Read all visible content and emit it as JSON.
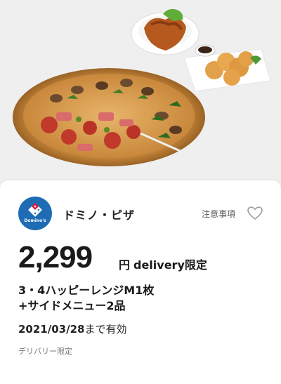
{
  "brand": {
    "name": "ドミノ・ピザ",
    "logo_text": "Domino's",
    "color": "#1e6db4",
    "accent": "#e31837"
  },
  "notes_link": "注意事項",
  "favorite_icon": "heart-outline-icon",
  "price": {
    "amount": "2,299",
    "currency": "円",
    "tag": "delivery限定"
  },
  "description": {
    "line1": "3・4ハッピーレンジM1枚",
    "line2": "+サイドメニュー2品"
  },
  "validity": {
    "date": "2021/03/28",
    "suffix": "まで有効"
  },
  "delivery_only": "デリバリー限定"
}
